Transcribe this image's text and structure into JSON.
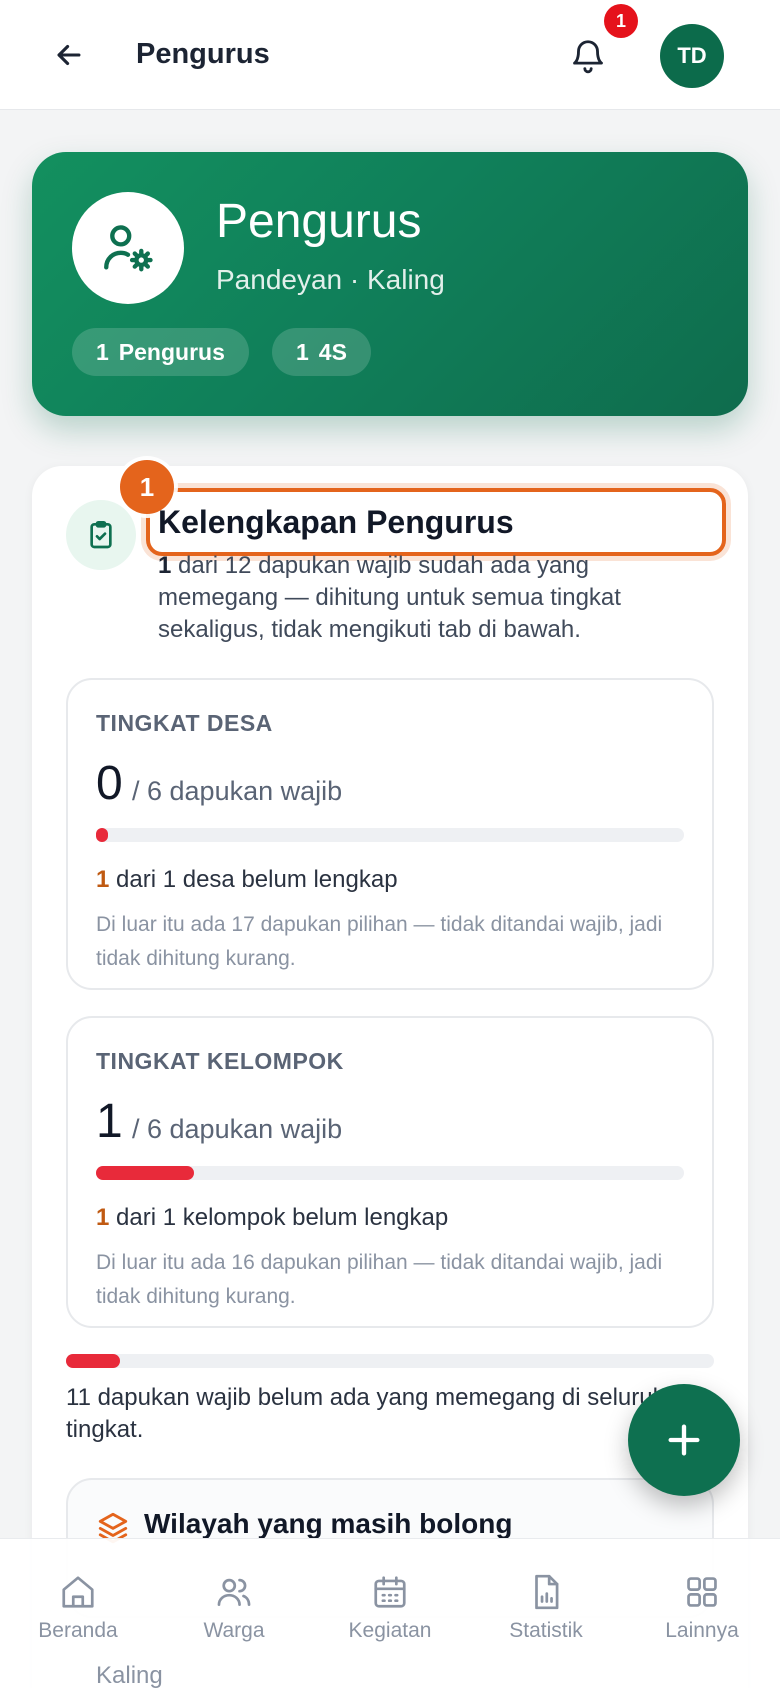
{
  "header": {
    "title": "Pengurus",
    "notification_count": "1",
    "avatar_initials": "TD"
  },
  "hero": {
    "title": "Pengurus",
    "subtitle": "Pandeyan · Kaling",
    "chips": [
      {
        "count": "1",
        "label": "Pengurus"
      },
      {
        "count": "1",
        "label": "4S"
      }
    ]
  },
  "completeness": {
    "step_number": "1",
    "title": "Kelengkapan Pengurus",
    "desc_count": "1",
    "desc_rest": " dari 12 dapukan wajib sudah ada yang memegang — dihitung untuk semua tingkat sekaligus, tidak mengikuti tab di bawah."
  },
  "levels": [
    {
      "label": "TINGKAT DESA",
      "filled": "0",
      "of_text": "/ 6 dapukan wajib",
      "progress": 0.02,
      "miss_count": "1",
      "miss_text": " dari 1 desa belum lengkap",
      "note": "Di luar itu ada 17 dapukan pilihan — tidak ditandai wajib, jadi tidak dihitung kurang."
    },
    {
      "label": "TINGKAT KELOMPOK",
      "filled": "1",
      "of_text": "/ 6 dapukan wajib",
      "progress": 0.1667,
      "miss_count": "1",
      "miss_text": " dari 1 kelompok belum lengkap",
      "note": "Di luar itu ada 16 dapukan pilihan — tidak ditandai wajib, jadi tidak dihitung kurang."
    }
  ],
  "total": {
    "progress": 0.0833,
    "text": "11 dapukan wajib belum ada yang memegang di seluruh tingkat."
  },
  "wilayah": {
    "title": "Wilayah yang masih bolong",
    "first_item": "Kaling"
  },
  "nav": [
    {
      "label": "Beranda",
      "icon": "home-icon"
    },
    {
      "label": "Warga",
      "icon": "users-icon"
    },
    {
      "label": "Kegiatan",
      "icon": "calendar-icon"
    },
    {
      "label": "Statistik",
      "icon": "chart-icon"
    },
    {
      "label": "Lainnya",
      "icon": "grid-icon"
    }
  ],
  "colors": {
    "brand": "#0e7050",
    "accent_orange": "#e4641c",
    "progress_red": "#e82a3a"
  }
}
